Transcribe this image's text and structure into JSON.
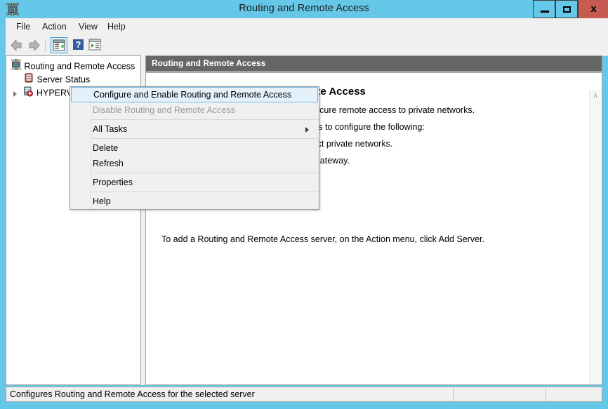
{
  "window": {
    "title": "Routing and Remote Access",
    "title_icon": "rras-server-icon",
    "controls": {
      "minimize": "—",
      "maximize": "□",
      "close": "x"
    },
    "colors": {
      "titlebar": "#66c8e8",
      "close_button": "#c75b51",
      "header_bar": "#666666",
      "highlight": "#e4f1fb",
      "highlight_border": "#70b8e8",
      "chrome": "#f0f0f0"
    }
  },
  "menubar": {
    "items": [
      {
        "label": "File"
      },
      {
        "label": "Action"
      },
      {
        "label": "View"
      },
      {
        "label": "Help"
      }
    ]
  },
  "toolbar": {
    "buttons": [
      {
        "name": "back-icon",
        "tooltip": "Back"
      },
      {
        "name": "forward-icon",
        "tooltip": "Forward"
      },
      {
        "name": "show-console-tree-icon",
        "tooltip": "Show/Hide Console Tree",
        "selected": true
      },
      {
        "name": "help-icon",
        "tooltip": "Help"
      },
      {
        "name": "show-action-pane-icon",
        "tooltip": "Show/Hide Action Pane"
      }
    ]
  },
  "tree": {
    "nodes": [
      {
        "label": "Routing and Remote Access",
        "icon": "rras-root-icon",
        "indent": 0,
        "expandable": false,
        "expanded": true
      },
      {
        "label": "Server Status",
        "icon": "server-status-icon",
        "indent": 1,
        "expandable": false
      },
      {
        "label": "HYPERV",
        "icon": "server-node-icon",
        "indent": 1,
        "expandable": true,
        "selected": true
      }
    ]
  },
  "content": {
    "header": "Routing and Remote Access",
    "welcome_title": "Welcome to Routing and Remote Access",
    "welcome_lines": [
      "Routing and Remote Access provides secure remote access to private networks.",
      "You can use Routing and Remote Access to configure the following:",
      "A virtual private network (VPN) to connect private networks.",
      "A dial-up remote access server or VPN gateway."
    ],
    "add_server_hint": "To add a Routing and Remote Access server, on the Action menu, click Add Server.",
    "scrollbar": {
      "up": "∧",
      "down": "∨"
    }
  },
  "context_menu": {
    "items": [
      {
        "label": "Configure and Enable Routing and Remote Access",
        "state": "highlight"
      },
      {
        "label": "Disable Routing and Remote Access",
        "state": "disabled"
      },
      {
        "separator": true
      },
      {
        "label": "All Tasks",
        "state": "normal",
        "submenu": true
      },
      {
        "separator": true
      },
      {
        "label": "Delete",
        "state": "normal"
      },
      {
        "label": "Refresh",
        "state": "normal"
      },
      {
        "separator": true
      },
      {
        "label": "Properties",
        "state": "normal"
      },
      {
        "separator": true
      },
      {
        "label": "Help",
        "state": "normal"
      }
    ]
  },
  "statusbar": {
    "message": "Configures Routing and Remote Access for the selected server",
    "panel2": "",
    "panel3": ""
  }
}
